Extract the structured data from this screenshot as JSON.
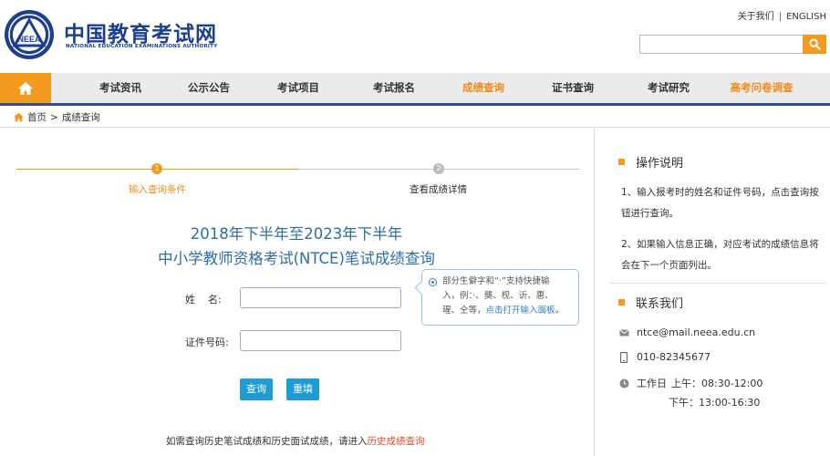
{
  "header": {
    "brand_cn": "中国教育考试网",
    "brand_en": "NATIONAL EDUCATION EXAMINATIONS AUTHORITY",
    "logo_text": "NEEA",
    "top_links": {
      "about": "关于我们",
      "separator": "|",
      "english": "ENGLISH"
    },
    "search": {
      "placeholder": ""
    }
  },
  "nav": {
    "items": [
      {
        "label": "考试资讯"
      },
      {
        "label": "公示公告"
      },
      {
        "label": "考试项目"
      },
      {
        "label": "考试报名"
      },
      {
        "label": "成绩查询",
        "active": true
      },
      {
        "label": "证书查询"
      },
      {
        "label": "考试研究"
      },
      {
        "label": "高考问卷调查",
        "highlight": true
      }
    ]
  },
  "breadcrumb": {
    "home": "首页",
    "separator": ">",
    "current": "成绩查询"
  },
  "steps": [
    {
      "num": "1",
      "label": "输入查询条件",
      "state": "active"
    },
    {
      "num": "2",
      "label": "查看成绩详情",
      "state": "pending"
    }
  ],
  "title": {
    "line1": "2018年下半年至2023年下半年",
    "line2": "中小学教师资格考试(NTCE)笔试成绩查询"
  },
  "form": {
    "name_label": "姓    名:",
    "name_value": "",
    "id_label": "证件号码:",
    "id_value": "",
    "submit": "查询",
    "reset": "重填"
  },
  "tip": {
    "line1": "部分生僻字和“·”支持快捷输",
    "line2": "入，例：·、龑、枧、䜣、惠、",
    "line3": "瑆、仝等，",
    "link": "点击打开输入面板",
    "end": "。"
  },
  "history": {
    "text": "如需查询历史笔试成绩和历史面试成绩，请进入",
    "link": "历史成绩查询"
  },
  "sidebar": {
    "help_title": "操作说明",
    "help_1": "1、输入报考时的姓名和证件号码，点击查询按钮进行查询。",
    "help_2": "2、如果输入信息正确，对应考试的成绩信息将会在下一个页面列出。",
    "contact_title": "联系我们",
    "email": "ntce@mail.neea.edu.cn",
    "phone": "010-82345677",
    "hours_label": "工作日",
    "hours_am": "上午：08:30-12:00",
    "hours_pm": "下午：13:00-16:30"
  },
  "colors": {
    "accent": "#f39b1f",
    "brand_blue": "#1d3f8f",
    "title_blue": "#2c6fa6",
    "button_blue": "#1f9bd5",
    "link_red": "#e34b2a"
  }
}
